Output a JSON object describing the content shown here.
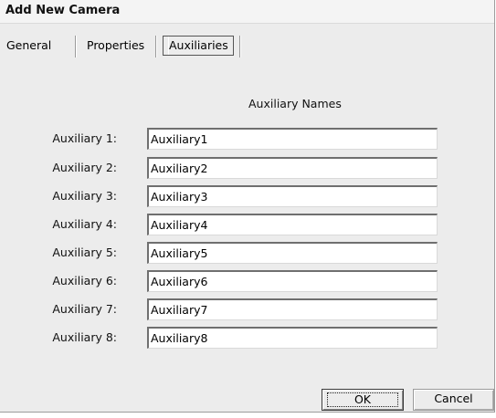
{
  "window": {
    "title": "Add New Camera"
  },
  "tabs": [
    {
      "label": "General"
    },
    {
      "label": "Properties"
    },
    {
      "label": "Auxiliaries"
    }
  ],
  "active_tab": "Auxiliaries",
  "auxiliaries": {
    "heading": "Auxiliary Names",
    "rows": [
      {
        "label": "Auxiliary 1:",
        "value": "Auxiliary1"
      },
      {
        "label": "Auxiliary 2:",
        "value": "Auxiliary2"
      },
      {
        "label": "Auxiliary 3:",
        "value": "Auxiliary3"
      },
      {
        "label": "Auxiliary 4:",
        "value": "Auxiliary4"
      },
      {
        "label": "Auxiliary 5:",
        "value": "Auxiliary5"
      },
      {
        "label": "Auxiliary 6:",
        "value": "Auxiliary6"
      },
      {
        "label": "Auxiliary 7:",
        "value": "Auxiliary7"
      },
      {
        "label": "Auxiliary 8:",
        "value": "Auxiliary8"
      }
    ]
  },
  "buttons": {
    "ok_label": "OK",
    "cancel_label": "Cancel"
  }
}
